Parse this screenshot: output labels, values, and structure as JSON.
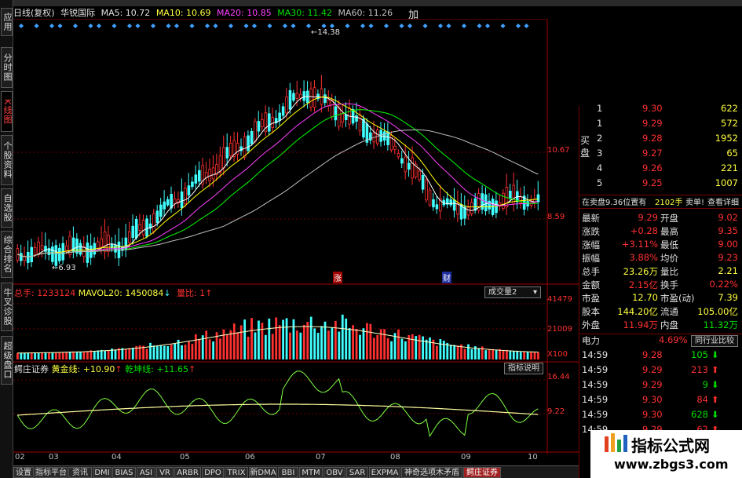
{
  "left_tabs": [
    {
      "label": "应用",
      "active": false
    },
    {
      "label": "分时图",
      "active": false
    },
    {
      "label": "K线图",
      "active": true
    },
    {
      "label": "个股资料",
      "active": false
    },
    {
      "label": "自选股",
      "active": false
    },
    {
      "label": "综合排名",
      "active": false
    },
    {
      "label": "牛叉诊股",
      "active": false
    },
    {
      "label": "超级盘口",
      "active": false
    }
  ],
  "header": {
    "period": "日线(复权)",
    "stock": "华锐国际",
    "ma5": "MA5: 10.72",
    "ma10": "MA10: 10.69",
    "ma20": "MA20: 10.85",
    "ma30": "MA30: 11.42",
    "ma60": "MA60: 11.26",
    "add": "加"
  },
  "price_axis": {
    "high_label": "10.67",
    "low_label": "8.59",
    "max_marker": "14.38",
    "min_marker": "6.93"
  },
  "event_marks": {
    "rise": "涨",
    "finance": "财"
  },
  "volume": {
    "total": "总手: 1233124",
    "mavol20": "MAVOL20: 1450084",
    "ratio": "量比: 1",
    "button": "成交量2",
    "axis": [
      "41479",
      "21009",
      "X100"
    ]
  },
  "indicator": {
    "name": "鳄庄证券",
    "gold": "黄金线: +10.90",
    "strength": "乾坤线: +11.65",
    "button": "指标说明",
    "axis": [
      "16.44",
      "9.22"
    ]
  },
  "x_axis": [
    "02",
    "03",
    "04",
    "05",
    "06",
    "07",
    "08",
    "09",
    "10"
  ],
  "bottom_tabs": [
    {
      "label": "设置",
      "active": false
    },
    {
      "label": "指标平台",
      "active": false
    },
    {
      "label": "资讯",
      "active": false
    },
    {
      "label": "DMI",
      "active": false
    },
    {
      "label": "BIAS",
      "active": false
    },
    {
      "label": "ASI",
      "active": false
    },
    {
      "label": "VR",
      "active": false
    },
    {
      "label": "ARBR",
      "active": false
    },
    {
      "label": "DPO",
      "active": false
    },
    {
      "label": "TRIX",
      "active": false
    },
    {
      "label": "新DMA",
      "active": false
    },
    {
      "label": "BBI",
      "active": false
    },
    {
      "label": "MTM",
      "active": false
    },
    {
      "label": "OBV",
      "active": false
    },
    {
      "label": "SAR",
      "active": false
    },
    {
      "label": "EXPMA",
      "active": false
    },
    {
      "label": "神奇选项木矛盾线",
      "active": false
    },
    {
      "label": "鳄庄证券",
      "active": true
    }
  ],
  "bids": [
    {
      "level": "1",
      "price": "9.30",
      "qty": "622"
    },
    {
      "level": "1",
      "price": "9.29",
      "qty": "572"
    },
    {
      "level": "2",
      "price": "9.28",
      "qty": "1952"
    },
    {
      "level": "3",
      "price": "9.27",
      "qty": "65"
    },
    {
      "level": "4",
      "price": "9.26",
      "qty": "221"
    },
    {
      "level": "5",
      "price": "9.25",
      "qty": "1007"
    }
  ],
  "bid_side_label": "买盘",
  "pending": {
    "text": "在卖盘9.36位置有",
    "qty": "2102手",
    "tag": "卖单!",
    "link": "查看详细"
  },
  "stats": [
    {
      "k1": "最新",
      "v1": "9.29",
      "k2": "开盘",
      "v2": "9.02"
    },
    {
      "k1": "涨跌",
      "v1": "+0.28",
      "k2": "最高",
      "v2": "9.35"
    },
    {
      "k1": "涨幅",
      "v1": "+3.11%",
      "k2": "最低",
      "v2": "9.00"
    },
    {
      "k1": "振幅",
      "v1": "3.88%",
      "k2": "均价",
      "v2": "9.23"
    },
    {
      "k1": "总手",
      "v1": "23.26万",
      "k2": "量比",
      "v2": "2.21"
    },
    {
      "k1": "金额",
      "v1": "2.15亿",
      "k2": "换手",
      "v2": "0.22%"
    },
    {
      "k1": "市盈",
      "v1": "12.70",
      "k2": "市盈(动)",
      "v2": "7.39"
    },
    {
      "k1": "股本",
      "v1": "144.20亿",
      "k2": "流通",
      "v2": "105.00亿"
    },
    {
      "k1": "外盘",
      "v1": "11.94万",
      "k2": "内盘",
      "v2": "11.32万"
    }
  ],
  "industry": {
    "name": "电力",
    "change": "4.69%",
    "button": "同行业比较"
  },
  "ticks": [
    {
      "time": "14:59",
      "price": "9.28",
      "qty": "105",
      "dir": "down"
    },
    {
      "time": "14:59",
      "price": "9.29",
      "qty": "213",
      "dir": "up"
    },
    {
      "time": "14:59",
      "price": "9.29",
      "qty": "9",
      "dir": "down"
    },
    {
      "time": "14:59",
      "price": "9.30",
      "qty": "84",
      "dir": "up"
    },
    {
      "time": "14:59",
      "price": "9.30",
      "qty": "628",
      "dir": "down"
    },
    {
      "time": "14:59",
      "price": "9.29",
      "qty": "62",
      "dir": "up"
    }
  ],
  "watermark": {
    "title": "指标公式网",
    "url": "www.zbgs3.com"
  },
  "colors": {
    "up": "#ff3030",
    "down": "#40ffff",
    "ma5": "#ffffff",
    "ma10": "#ffff00",
    "ma20": "#ff40ff",
    "ma30": "#00ff00",
    "ma60": "#c0c0c0"
  }
}
